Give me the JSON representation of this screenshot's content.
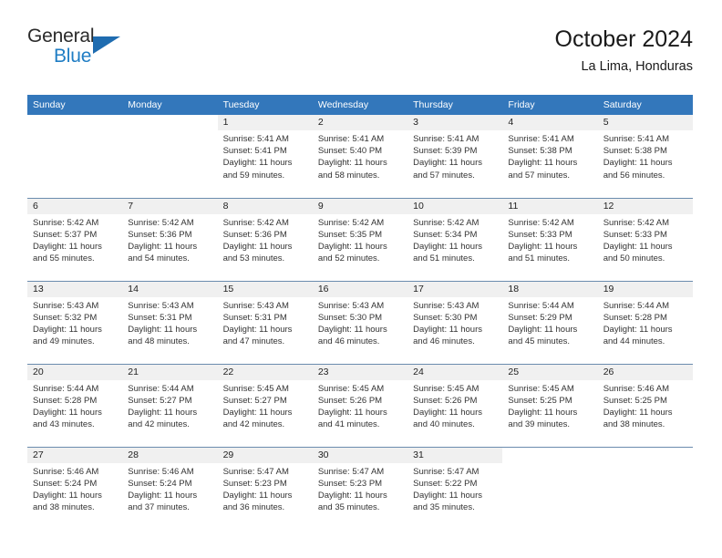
{
  "logo": {
    "word_top": "General",
    "word_bottom": "Blue",
    "triangle_icon": "blue-triangle-icon",
    "accent_color": "#1f7dc4",
    "triangle_color": "#1f6cb0"
  },
  "header": {
    "title": "October 2024",
    "subtitle": "La Lima, Honduras"
  },
  "theme": {
    "header_row_bg": "#3377bb",
    "header_row_text": "#ffffff",
    "daynum_band_bg": "#f0f0f0",
    "row_divider": "#6b8cae",
    "body_text": "#333333"
  },
  "weekdays": [
    "Sunday",
    "Monday",
    "Tuesday",
    "Wednesday",
    "Thursday",
    "Friday",
    "Saturday"
  ],
  "labels": {
    "sunrise_prefix": "Sunrise:",
    "sunset_prefix": "Sunset:",
    "daylight_prefix": "Daylight:"
  },
  "weeks": [
    [
      {
        "day": "",
        "blank": true,
        "lines": [
          "",
          "",
          "",
          ""
        ]
      },
      {
        "day": "",
        "blank": true,
        "lines": [
          "",
          "",
          "",
          ""
        ]
      },
      {
        "day": "1",
        "lines": [
          "Sunrise: 5:41 AM",
          "Sunset: 5:41 PM",
          "Daylight: 11 hours",
          "and 59 minutes."
        ]
      },
      {
        "day": "2",
        "lines": [
          "Sunrise: 5:41 AM",
          "Sunset: 5:40 PM",
          "Daylight: 11 hours",
          "and 58 minutes."
        ]
      },
      {
        "day": "3",
        "lines": [
          "Sunrise: 5:41 AM",
          "Sunset: 5:39 PM",
          "Daylight: 11 hours",
          "and 57 minutes."
        ]
      },
      {
        "day": "4",
        "lines": [
          "Sunrise: 5:41 AM",
          "Sunset: 5:38 PM",
          "Daylight: 11 hours",
          "and 57 minutes."
        ]
      },
      {
        "day": "5",
        "lines": [
          "Sunrise: 5:41 AM",
          "Sunset: 5:38 PM",
          "Daylight: 11 hours",
          "and 56 minutes."
        ]
      }
    ],
    [
      {
        "day": "6",
        "lines": [
          "Sunrise: 5:42 AM",
          "Sunset: 5:37 PM",
          "Daylight: 11 hours",
          "and 55 minutes."
        ]
      },
      {
        "day": "7",
        "lines": [
          "Sunrise: 5:42 AM",
          "Sunset: 5:36 PM",
          "Daylight: 11 hours",
          "and 54 minutes."
        ]
      },
      {
        "day": "8",
        "lines": [
          "Sunrise: 5:42 AM",
          "Sunset: 5:36 PM",
          "Daylight: 11 hours",
          "and 53 minutes."
        ]
      },
      {
        "day": "9",
        "lines": [
          "Sunrise: 5:42 AM",
          "Sunset: 5:35 PM",
          "Daylight: 11 hours",
          "and 52 minutes."
        ]
      },
      {
        "day": "10",
        "lines": [
          "Sunrise: 5:42 AM",
          "Sunset: 5:34 PM",
          "Daylight: 11 hours",
          "and 51 minutes."
        ]
      },
      {
        "day": "11",
        "lines": [
          "Sunrise: 5:42 AM",
          "Sunset: 5:33 PM",
          "Daylight: 11 hours",
          "and 51 minutes."
        ]
      },
      {
        "day": "12",
        "lines": [
          "Sunrise: 5:42 AM",
          "Sunset: 5:33 PM",
          "Daylight: 11 hours",
          "and 50 minutes."
        ]
      }
    ],
    [
      {
        "day": "13",
        "lines": [
          "Sunrise: 5:43 AM",
          "Sunset: 5:32 PM",
          "Daylight: 11 hours",
          "and 49 minutes."
        ]
      },
      {
        "day": "14",
        "lines": [
          "Sunrise: 5:43 AM",
          "Sunset: 5:31 PM",
          "Daylight: 11 hours",
          "and 48 minutes."
        ]
      },
      {
        "day": "15",
        "lines": [
          "Sunrise: 5:43 AM",
          "Sunset: 5:31 PM",
          "Daylight: 11 hours",
          "and 47 minutes."
        ]
      },
      {
        "day": "16",
        "lines": [
          "Sunrise: 5:43 AM",
          "Sunset: 5:30 PM",
          "Daylight: 11 hours",
          "and 46 minutes."
        ]
      },
      {
        "day": "17",
        "lines": [
          "Sunrise: 5:43 AM",
          "Sunset: 5:30 PM",
          "Daylight: 11 hours",
          "and 46 minutes."
        ]
      },
      {
        "day": "18",
        "lines": [
          "Sunrise: 5:44 AM",
          "Sunset: 5:29 PM",
          "Daylight: 11 hours",
          "and 45 minutes."
        ]
      },
      {
        "day": "19",
        "lines": [
          "Sunrise: 5:44 AM",
          "Sunset: 5:28 PM",
          "Daylight: 11 hours",
          "and 44 minutes."
        ]
      }
    ],
    [
      {
        "day": "20",
        "lines": [
          "Sunrise: 5:44 AM",
          "Sunset: 5:28 PM",
          "Daylight: 11 hours",
          "and 43 minutes."
        ]
      },
      {
        "day": "21",
        "lines": [
          "Sunrise: 5:44 AM",
          "Sunset: 5:27 PM",
          "Daylight: 11 hours",
          "and 42 minutes."
        ]
      },
      {
        "day": "22",
        "lines": [
          "Sunrise: 5:45 AM",
          "Sunset: 5:27 PM",
          "Daylight: 11 hours",
          "and 42 minutes."
        ]
      },
      {
        "day": "23",
        "lines": [
          "Sunrise: 5:45 AM",
          "Sunset: 5:26 PM",
          "Daylight: 11 hours",
          "and 41 minutes."
        ]
      },
      {
        "day": "24",
        "lines": [
          "Sunrise: 5:45 AM",
          "Sunset: 5:26 PM",
          "Daylight: 11 hours",
          "and 40 minutes."
        ]
      },
      {
        "day": "25",
        "lines": [
          "Sunrise: 5:45 AM",
          "Sunset: 5:25 PM",
          "Daylight: 11 hours",
          "and 39 minutes."
        ]
      },
      {
        "day": "26",
        "lines": [
          "Sunrise: 5:46 AM",
          "Sunset: 5:25 PM",
          "Daylight: 11 hours",
          "and 38 minutes."
        ]
      }
    ],
    [
      {
        "day": "27",
        "lines": [
          "Sunrise: 5:46 AM",
          "Sunset: 5:24 PM",
          "Daylight: 11 hours",
          "and 38 minutes."
        ]
      },
      {
        "day": "28",
        "lines": [
          "Sunrise: 5:46 AM",
          "Sunset: 5:24 PM",
          "Daylight: 11 hours",
          "and 37 minutes."
        ]
      },
      {
        "day": "29",
        "lines": [
          "Sunrise: 5:47 AM",
          "Sunset: 5:23 PM",
          "Daylight: 11 hours",
          "and 36 minutes."
        ]
      },
      {
        "day": "30",
        "lines": [
          "Sunrise: 5:47 AM",
          "Sunset: 5:23 PM",
          "Daylight: 11 hours",
          "and 35 minutes."
        ]
      },
      {
        "day": "31",
        "lines": [
          "Sunrise: 5:47 AM",
          "Sunset: 5:22 PM",
          "Daylight: 11 hours",
          "and 35 minutes."
        ]
      },
      {
        "day": "",
        "blank": true,
        "lines": [
          "",
          "",
          "",
          ""
        ]
      },
      {
        "day": "",
        "blank": true,
        "lines": [
          "",
          "",
          "",
          ""
        ]
      }
    ]
  ]
}
